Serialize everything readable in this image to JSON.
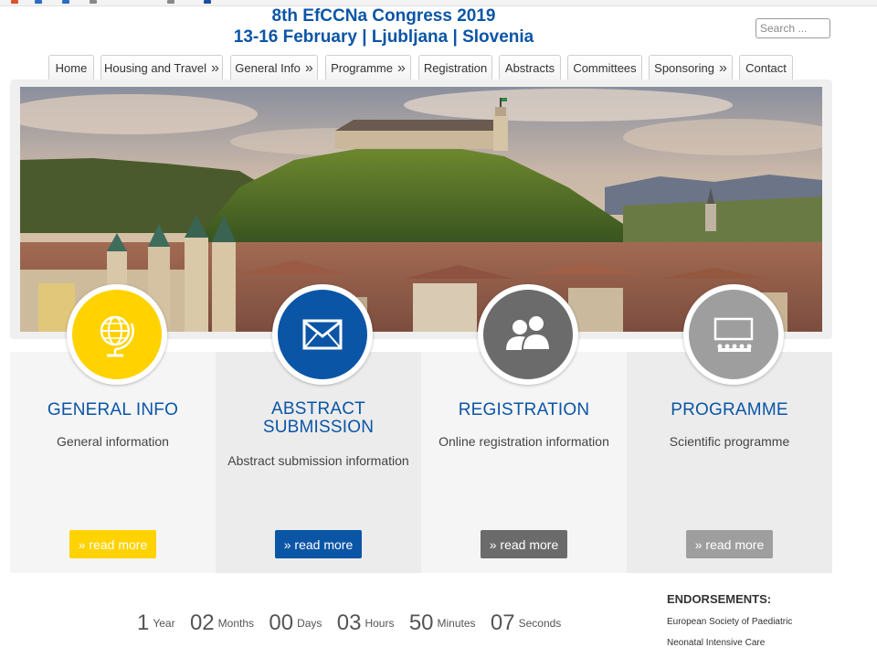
{
  "header": {
    "title_line1": "8th EfCCNa Congress 2019",
    "title_line2": "13-16 February | Ljubljana | Slovenia"
  },
  "search": {
    "placeholder": "Search ..."
  },
  "nav": {
    "items": [
      {
        "label": "Home",
        "has_submenu": false
      },
      {
        "label": "Housing and Travel",
        "has_submenu": true
      },
      {
        "label": "General Info",
        "has_submenu": true
      },
      {
        "label": "Programme",
        "has_submenu": true
      },
      {
        "label": "Registration",
        "has_submenu": false
      },
      {
        "label": "Abstracts",
        "has_submenu": false
      },
      {
        "label": "Committees",
        "has_submenu": false
      },
      {
        "label": "Sponsoring",
        "has_submenu": true
      },
      {
        "label": "Contact",
        "has_submenu": false
      }
    ],
    "submenu_glyph": "»"
  },
  "cards": [
    {
      "title": "GENERAL INFO",
      "description": "General information",
      "button": "» read more",
      "icon": "globe-icon",
      "color": "#ffd200"
    },
    {
      "title": "ABSTRACT SUBMISSION",
      "description": "Abstract submission information",
      "button": "» read more",
      "icon": "envelope-icon",
      "color": "#0b55a6"
    },
    {
      "title": "REGISTRATION",
      "description": "Online registration information",
      "button": "» read more",
      "icon": "users-icon",
      "color": "#6b6b6b"
    },
    {
      "title": "PROGRAMME",
      "description": "Scientific programme",
      "button": "» read more",
      "icon": "presentation-icon",
      "color": "#9e9e9e"
    }
  ],
  "countdown": [
    {
      "value": "1",
      "unit": "Year"
    },
    {
      "value": "02",
      "unit": "Months"
    },
    {
      "value": "00",
      "unit": "Days"
    },
    {
      "value": "03",
      "unit": "Hours"
    },
    {
      "value": "50",
      "unit": "Minutes"
    },
    {
      "value": "07",
      "unit": "Seconds"
    }
  ],
  "endorsements": {
    "title": "ENDORSEMENTS:",
    "items": [
      "European Society of Paediatric",
      "Neonatal Intensive Care"
    ]
  },
  "colors": {
    "brand_blue": "#0b55a6",
    "yellow": "#ffd200",
    "dark_gray": "#6b6b6b",
    "light_gray": "#9e9e9e"
  }
}
